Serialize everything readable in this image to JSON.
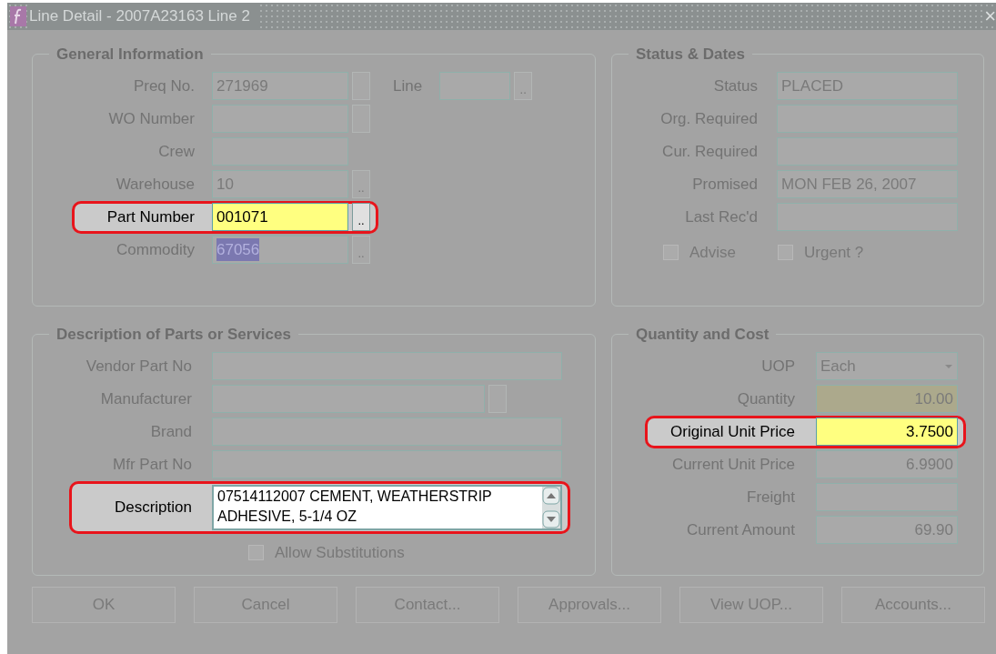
{
  "window": {
    "title": "Line Detail - 2007A23163 Line 2",
    "close": "×"
  },
  "sections": [
    {
      "title": "General Information",
      "fields": [
        {
          "label": "Preq No.",
          "value": "271969",
          "kind": "text",
          "lov_blank": true,
          "highlighted": false,
          "required": false,
          "text_selected": false,
          "extra": {
            "label": "Line",
            "lov": ".."
          }
        },
        {
          "label": "WO Number",
          "kind": "text",
          "lov_blank": true,
          "highlighted": false,
          "required": false
        },
        {
          "label": "Crew",
          "kind": "text",
          "highlighted": false,
          "required": false
        },
        {
          "label": "Warehouse",
          "value": "10",
          "kind": "text",
          "lov": "..",
          "highlighted": false,
          "required": false,
          "text_selected": false
        },
        {
          "label": "Part Number",
          "value": "001071",
          "kind": "text",
          "lov": "..",
          "highlighted": true,
          "required": true,
          "text_selected": false
        },
        {
          "label": "Commodity",
          "value": "67056",
          "kind": "text",
          "lov": "..",
          "highlighted": false,
          "required": false,
          "text_selected": true
        }
      ]
    },
    {
      "title": "Status & Dates",
      "fields": [
        {
          "label": "Status",
          "value": "PLACED",
          "kind": "text",
          "highlighted": false,
          "required": false
        },
        {
          "label": "Org. Required",
          "kind": "text",
          "highlighted": false,
          "required": false
        },
        {
          "label": "Cur. Required",
          "kind": "text",
          "highlighted": false,
          "required": false
        },
        {
          "label": "Promised",
          "value": "MON FEB 26, 2007",
          "kind": "text",
          "highlighted": false,
          "required": false
        },
        {
          "label": "Last Rec'd",
          "kind": "text",
          "highlighted": false,
          "required": false
        }
      ],
      "checkboxes": [
        {
          "label": "Advise",
          "checked": false
        },
        {
          "label": "Urgent ?",
          "checked": false
        }
      ]
    },
    {
      "title": "Description of Parts or Services",
      "fields": [
        {
          "label": "Vendor Part No",
          "kind": "text",
          "highlighted": false,
          "required": false
        },
        {
          "label": "Manufacturer",
          "kind": "text",
          "lov_blank": true,
          "highlighted": false,
          "required": false
        },
        {
          "label": "Brand",
          "kind": "text",
          "highlighted": false,
          "required": false
        },
        {
          "label": "Mfr Part No",
          "kind": "text",
          "highlighted": false,
          "required": false
        },
        {
          "label": "Description",
          "value": "07514112007 CEMENT, WEATHERSTRIP ADHESIVE, 5-1/4 OZ",
          "kind": "textarea",
          "highlighted": true,
          "required": false
        }
      ],
      "checkboxes": [
        {
          "label": "Allow Substitutions",
          "checked": false
        }
      ]
    },
    {
      "title": "Quantity and Cost",
      "fields": [
        {
          "label": "UOP",
          "value": "Each",
          "kind": "dropdown",
          "highlighted": false,
          "required": false
        },
        {
          "label": "Quantity",
          "value": "10.00",
          "kind": "number",
          "highlighted": false,
          "required": true
        },
        {
          "label": "Original Unit Price",
          "value": "3.7500",
          "kind": "number",
          "highlighted": true,
          "required": true
        },
        {
          "label": "Current Unit Price",
          "value": "6.9900",
          "kind": "number",
          "highlighted": false,
          "required": false
        },
        {
          "label": "Freight",
          "kind": "number",
          "highlighted": false,
          "required": false
        },
        {
          "label": "Current Amount",
          "value": "69.90",
          "kind": "number",
          "highlighted": false,
          "required": false
        }
      ]
    }
  ],
  "buttons": [
    "OK",
    "Cancel",
    "Contact...",
    "Approvals...",
    "View UOP...",
    "Accounts..."
  ]
}
